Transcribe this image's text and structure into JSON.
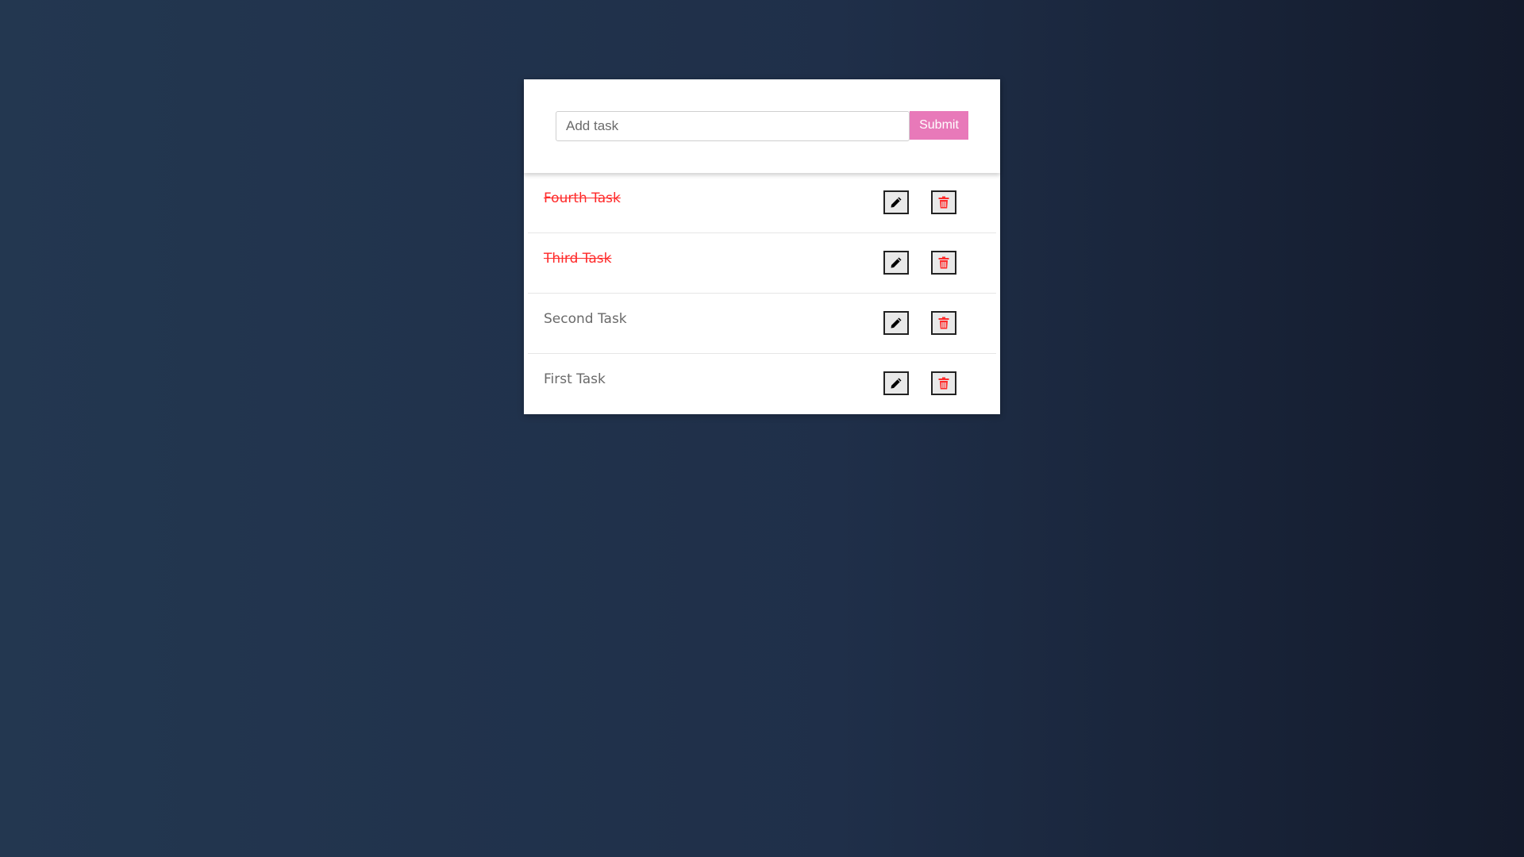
{
  "form": {
    "input_value": "",
    "input_placeholder": "Add task",
    "submit_label": "Submit"
  },
  "tasks": [
    {
      "label": "Fourth Task",
      "completed": true
    },
    {
      "label": "Third Task",
      "completed": true
    },
    {
      "label": "Second Task",
      "completed": false
    },
    {
      "label": "First Task",
      "completed": false
    }
  ],
  "icons": {
    "edit": "pencil-icon",
    "delete": "trash-icon"
  },
  "colors": {
    "accent": "#e879b9",
    "completed_text": "#ff2a2a",
    "delete_icon": "#ff2a2a"
  }
}
